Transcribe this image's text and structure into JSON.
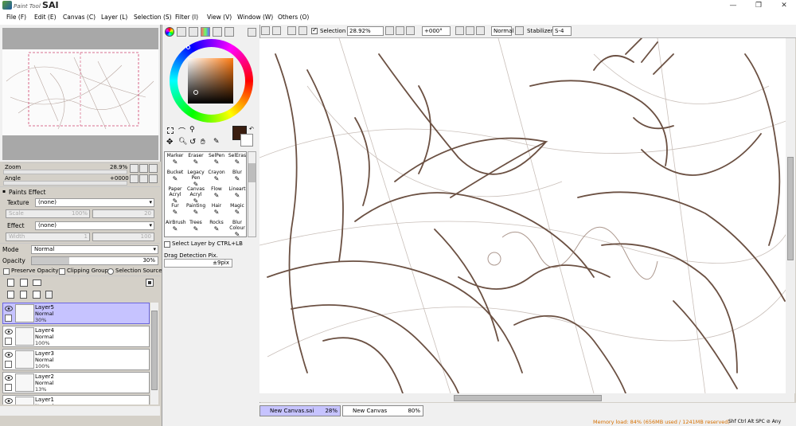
{
  "app": {
    "logo_small": "Paint Tool",
    "logo_big": "SAI",
    "window_controls": {
      "minimize": "—",
      "maximize": "❐",
      "close": "✕"
    }
  },
  "menu": [
    "File (F)",
    "Edit (E)",
    "Canvas (C)",
    "Layer (L)",
    "Selection (S)",
    "Filter (I)",
    "View (V)",
    "Window (W)",
    "Others (O)"
  ],
  "toolbar": {
    "selection_label": "Selection",
    "selection_checked": true,
    "zoom": "28.92%",
    "angle": "+000°",
    "blend_mode": "Normal",
    "stabilizer_label": "Stabilizer",
    "stabilizer_value": "S-4"
  },
  "navigator": {
    "zoom_label": "Zoom",
    "zoom_value": "28.9%",
    "angle_label": "Angle",
    "angle_value": "+0000"
  },
  "paint_effect": {
    "title": "Paints Effect",
    "texture_label": "Texture",
    "texture_value": "(none)",
    "scale_label": "Scale",
    "scale_value": "100%",
    "scale_right": "20",
    "effect_label": "Effect",
    "effect_value": "(none)",
    "width_label": "Width",
    "width_value": "1",
    "width_right": "100"
  },
  "layer_props": {
    "mode_label": "Mode",
    "mode_value": "Normal",
    "opacity_label": "Opacity",
    "opacity_value": "30%",
    "preserve_opacity": "Preserve Opacity",
    "clipping_group": "Clipping Group",
    "selection_source": "Selection Source"
  },
  "layers": [
    {
      "name": "Layer5",
      "mode": "Normal",
      "opacity": "30%",
      "selected": true
    },
    {
      "name": "Layer4",
      "mode": "Normal",
      "opacity": "100%",
      "selected": false
    },
    {
      "name": "Layer3",
      "mode": "Normal",
      "opacity": "100%",
      "selected": false
    },
    {
      "name": "Layer2",
      "mode": "Normal",
      "opacity": "13%",
      "selected": false
    },
    {
      "name": "Layer1",
      "mode": "Normal",
      "opacity": "",
      "selected": false
    }
  ],
  "brushes": [
    [
      "Marker",
      "Eraser",
      "SelPen",
      "SelEras"
    ],
    [
      "Bucket",
      "Legacy Pen",
      "Crayon",
      "Blur"
    ],
    [
      "Paper Acryl",
      "Canvas Acryl",
      "Flow",
      "Lineart"
    ],
    [
      "Fur",
      "Painting",
      "Hair",
      "Magic"
    ],
    [
      "AirBrush",
      "Trees",
      "Rocks",
      "Blur Colour"
    ]
  ],
  "tool_options": {
    "select_layer_ctrl": "Select Layer by CTRL+LB",
    "drag_detection_label": "Drag Detection Pix.",
    "drag_detection_value": "±9pix"
  },
  "colors": {
    "primary": "#3a1e10",
    "secondary": "#ffffff",
    "line": "#6b5042",
    "selected_layer": "#c6c3ff",
    "status_text": "#d56f00"
  },
  "canvas_tabs": [
    {
      "name": "New Canvas.sai",
      "zoom": "28%",
      "active": true
    },
    {
      "name": "New Canvas",
      "zoom": "80%",
      "active": false
    }
  ],
  "status": {
    "memory": "Memory load: 84% (656MB used / 1241MB reserved)",
    "keys": "Shf Ctrl Alt SPC ⊘ Any"
  }
}
